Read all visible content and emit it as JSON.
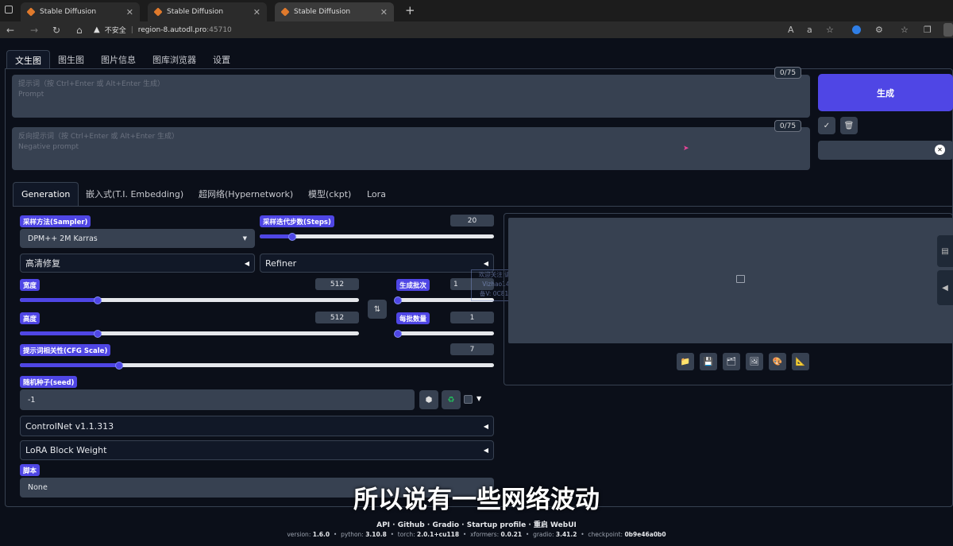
{
  "browser": {
    "tabs": [
      {
        "title": "Stable Diffusion"
      },
      {
        "title": "Stable Diffusion"
      },
      {
        "title": "Stable Diffusion"
      }
    ],
    "security_label": "不安全",
    "url_host": "region-8.autodl.pro",
    "url_port": ":45710"
  },
  "top_tabs": [
    "文生图",
    "图生图",
    "图片信息",
    "图库浏览器",
    "设置"
  ],
  "prompt": {
    "placeholder": "提示词（按 Ctrl+Enter 或 Alt+Enter 生成）",
    "placeholder_en": "Prompt",
    "counter": "0/75"
  },
  "negative_prompt": {
    "placeholder": "反向提示词（按 Ctrl+Enter 或 Alt+Enter 生成）",
    "placeholder_en": "Negative prompt",
    "counter": "0/75"
  },
  "generate_label": "生成",
  "sub_tabs": [
    "Generation",
    "嵌入式(T.I. Embedding)",
    "超网络(Hypernetwork)",
    "模型(ckpt)",
    "Lora"
  ],
  "sampler": {
    "label": "采样方法(Sampler)",
    "value": "DPM++ 2M Karras"
  },
  "steps": {
    "label": "采样迭代步数(Steps)",
    "value": "20",
    "fraction": 0.14
  },
  "hires": {
    "label": "高清修复"
  },
  "refiner": {
    "label": "Refiner"
  },
  "width": {
    "label": "宽度",
    "value": "512",
    "fraction": 0.23
  },
  "height": {
    "label": "高度",
    "value": "512",
    "fraction": 0.23
  },
  "batch_count": {
    "label": "生成批次",
    "value": "1",
    "fraction": 0.02
  },
  "batch_size": {
    "label": "每批数量",
    "value": "1",
    "fraction": 0.02
  },
  "cfg": {
    "label": "提示词相关性(CFG Scale)",
    "value": "7",
    "fraction": 0.21
  },
  "seed": {
    "label": "随机种子(seed)",
    "value": "-1"
  },
  "controlnet": {
    "label": "ControlNet v1.1.313"
  },
  "lora_block": {
    "label": "LoRA Block Weight"
  },
  "script": {
    "label": "脚本",
    "value": "None"
  },
  "watermark": [
    "欢迎关注 请你收藏",
    "Vizhao147146",
    "备V: 0C8147146"
  ],
  "subtitle": "所以说有一些网络波动",
  "footer": {
    "links": "API · Github · Gradio · Startup profile · 重启 WebUI",
    "version_label": "version:",
    "version": "1.6.0",
    "python_label": "python:",
    "python": "3.10.8",
    "torch_label": "torch:",
    "torch": "2.0.1+cu118",
    "xformers_label": "xformers:",
    "xformers": "0.0.21",
    "gradio_label": "gradio:",
    "gradio": "3.41.2",
    "checkpoint_label": "checkpoint:",
    "checkpoint": "0b9e46a0b0"
  },
  "icons": [
    "folder-icon",
    "save-icon",
    "zip-icon",
    "image-icon",
    "palette-icon",
    "ruler-icon",
    "dice-icon",
    "recycle-icon",
    "swap-icon",
    "trash-icon",
    "check-icon",
    "close-icon"
  ],
  "colors": {
    "accent": "#4f46e5",
    "bg": "#0b0f19",
    "input": "#374151"
  }
}
